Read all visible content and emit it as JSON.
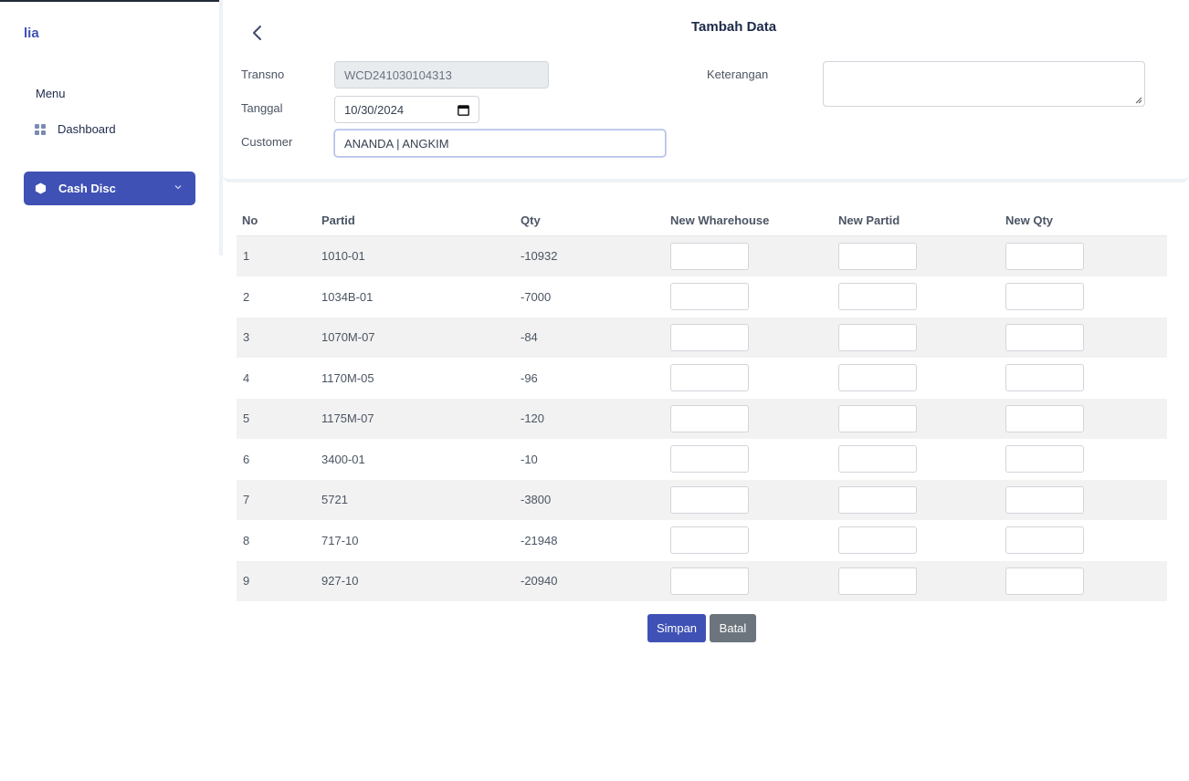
{
  "sidebar": {
    "brand": "lia",
    "menu_label": "Menu",
    "items": [
      {
        "label": "Dashboard",
        "icon": "grid-icon"
      },
      {
        "label": "Cash Disc",
        "icon": "hexagon-icon",
        "active": true
      }
    ]
  },
  "form": {
    "title": "Tambah Data",
    "transno_label": "Transno",
    "transno_value": "WCD241030104313",
    "tanggal_label": "Tanggal",
    "tanggal_value": "10/30/2024",
    "customer_label": "Customer",
    "customer_value": "ANANDA | ANGKIM",
    "keterangan_label": "Keterangan",
    "keterangan_value": ""
  },
  "table": {
    "headers": [
      "No",
      "Partid",
      "Qty",
      "New Wharehouse",
      "New Partid",
      "New Qty"
    ],
    "rows": [
      {
        "no": "1",
        "partid": "1010-01",
        "qty": "-10932"
      },
      {
        "no": "2",
        "partid": "1034B-01",
        "qty": "-7000"
      },
      {
        "no": "3",
        "partid": "1070M-07",
        "qty": "-84"
      },
      {
        "no": "4",
        "partid": "1170M-05",
        "qty": "-96"
      },
      {
        "no": "5",
        "partid": "1175M-07",
        "qty": "-120"
      },
      {
        "no": "6",
        "partid": "3400-01",
        "qty": "-10"
      },
      {
        "no": "7",
        "partid": "5721",
        "qty": "-3800"
      },
      {
        "no": "8",
        "partid": "717-10",
        "qty": "-21948"
      },
      {
        "no": "9",
        "partid": "927-10",
        "qty": "-20940"
      }
    ]
  },
  "actions": {
    "save_label": "Simpan",
    "cancel_label": "Batal"
  },
  "colors": {
    "primary": "#3f51b5",
    "secondary": "#6c757d",
    "row_alt": "#f2f2f2"
  }
}
